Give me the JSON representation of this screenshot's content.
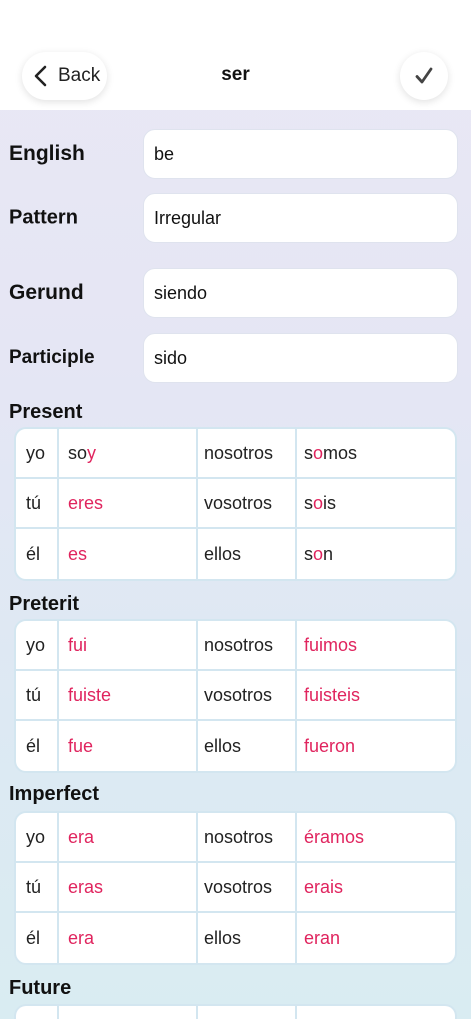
{
  "header": {
    "back_label": "Back",
    "title": "ser"
  },
  "fields": [
    {
      "label": "English",
      "value": "be"
    },
    {
      "label": "Pattern",
      "value": "Irregular"
    },
    {
      "label": "Gerund",
      "value": "siendo"
    },
    {
      "label": "Participle",
      "value": "sido"
    }
  ],
  "sections": [
    {
      "title": "Present",
      "rows": [
        {
          "p1": "yo",
          "f1": {
            "stem": "so",
            "end": "y",
            "tail": ""
          },
          "p2": "nosotros",
          "f2": {
            "stem": "s",
            "end": "o",
            "tail": "mos"
          }
        },
        {
          "p1": "tú",
          "f1": {
            "stem": "",
            "end": "eres",
            "tail": ""
          },
          "p2": "vosotros",
          "f2": {
            "stem": "s",
            "end": "o",
            "tail": "is"
          }
        },
        {
          "p1": "él",
          "f1": {
            "stem": "",
            "end": "es",
            "tail": ""
          },
          "p2": "ellos",
          "f2": {
            "stem": "s",
            "end": "o",
            "tail": "n"
          }
        }
      ]
    },
    {
      "title": "Preterit",
      "rows": [
        {
          "p1": "yo",
          "f1": {
            "stem": "",
            "end": "fui",
            "tail": ""
          },
          "p2": "nosotros",
          "f2": {
            "stem": "",
            "end": "fuimos",
            "tail": ""
          }
        },
        {
          "p1": "tú",
          "f1": {
            "stem": "",
            "end": "fuiste",
            "tail": ""
          },
          "p2": "vosotros",
          "f2": {
            "stem": "",
            "end": "fuisteis",
            "tail": ""
          }
        },
        {
          "p1": "él",
          "f1": {
            "stem": "",
            "end": "fue",
            "tail": ""
          },
          "p2": "ellos",
          "f2": {
            "stem": "",
            "end": "fueron",
            "tail": ""
          }
        }
      ]
    },
    {
      "title": "Imperfect",
      "rows": [
        {
          "p1": "yo",
          "f1": {
            "stem": "",
            "end": "era",
            "tail": ""
          },
          "p2": "nosotros",
          "f2": {
            "stem": "",
            "end": "éramos",
            "tail": ""
          }
        },
        {
          "p1": "tú",
          "f1": {
            "stem": "",
            "end": "eras",
            "tail": ""
          },
          "p2": "vosotros",
          "f2": {
            "stem": "",
            "end": "erais",
            "tail": ""
          }
        },
        {
          "p1": "él",
          "f1": {
            "stem": "",
            "end": "era",
            "tail": ""
          },
          "p2": "ellos",
          "f2": {
            "stem": "",
            "end": "eran",
            "tail": ""
          }
        }
      ]
    },
    {
      "title": "Future",
      "rows": [
        {
          "p1": "",
          "f1": {
            "stem": "",
            "end": "",
            "tail": ""
          },
          "p2": "",
          "f2": {
            "stem": "",
            "end": "",
            "tail": ""
          }
        }
      ]
    }
  ],
  "colors": {
    "irregular_highlight": "#e0245e"
  },
  "icons": {
    "back": "chevron-left-icon",
    "confirm": "checkmark-icon"
  }
}
